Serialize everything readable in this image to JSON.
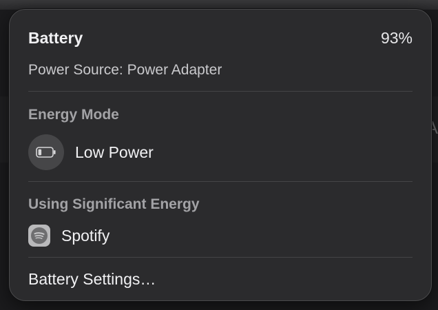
{
  "battery": {
    "title": "Battery",
    "percent": "93%",
    "power_source": "Power Source: Power Adapter"
  },
  "energy_mode": {
    "section_title": "Energy Mode",
    "mode_label": "Low Power",
    "icon": "battery-low-power-icon"
  },
  "significant_energy": {
    "section_title": "Using Significant Energy",
    "apps": [
      {
        "label": "Spotify",
        "icon": "spotify-icon"
      }
    ]
  },
  "footer": {
    "settings_label": "Battery Settings…"
  },
  "colors": {
    "panel_bg": "#2b2b2d",
    "text_primary": "#f1f1f3",
    "text_secondary": "#a3a3a6"
  }
}
